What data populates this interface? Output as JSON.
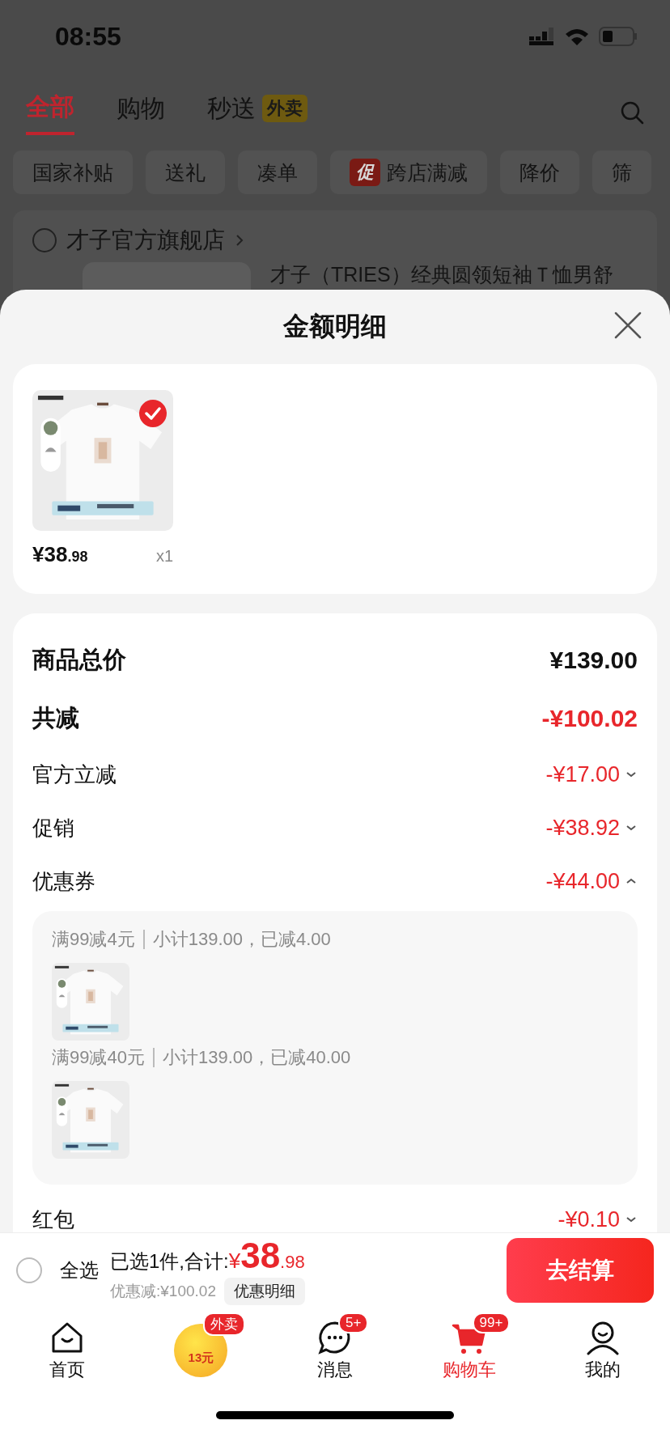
{
  "status_bar": {
    "time": "08:55"
  },
  "top_tabs": [
    {
      "label": "全部",
      "selected": true
    },
    {
      "label": "购物",
      "selected": false
    },
    {
      "label": "秒送",
      "selected": false,
      "badge": "外卖"
    }
  ],
  "filter_chips": [
    {
      "label": "国家补贴"
    },
    {
      "label": "送礼"
    },
    {
      "label": "凑单"
    },
    {
      "label": "跨店满减",
      "tag": "促"
    },
    {
      "label": "降价"
    },
    {
      "label": "筛"
    }
  ],
  "store": {
    "name": "才子官方旗舰店",
    "checked": false,
    "product_title": "才子（TRIES）经典圆领短袖Ｔ恤男舒"
  },
  "sheet": {
    "title": "金额明细",
    "items": [
      {
        "price": "¥38",
        "price_decimal": ".98",
        "quantity": "x1",
        "checked": true
      }
    ],
    "summary": [
      {
        "label": "商品总价",
        "value": "¥139.00",
        "kind": "total"
      },
      {
        "label": "共减",
        "value": "-¥100.02",
        "kind": "discount_total"
      },
      {
        "label": "官方立减",
        "value": "-¥17.00",
        "kind": "discount",
        "expanded": false
      },
      {
        "label": "促销",
        "value": "-¥38.92",
        "kind": "discount",
        "expanded": false
      },
      {
        "label": "优惠券",
        "value": "-¥44.00",
        "kind": "discount",
        "expanded": true,
        "breakdown": [
          {
            "rule": "满99减4元",
            "detail": "小计139.00，已减4.00"
          },
          {
            "rule": "满99减40元",
            "detail": "小计139.00，已减40.00"
          }
        ]
      },
      {
        "label": "红包",
        "value": "-¥0.10",
        "kind": "discount",
        "expanded": false
      }
    ]
  },
  "checkout": {
    "select_all": {
      "label": "全选",
      "checked": false
    },
    "summary": "已选1件,合计:",
    "currency": "¥",
    "amount": "38",
    "decimal": ".98",
    "savings": "优惠减:¥100.02",
    "details_button": "优惠明细",
    "submit": "去结算"
  },
  "tab_bar": [
    {
      "label": "首页",
      "kind": "home",
      "selected": false
    },
    {
      "kind": "promo",
      "text": "13元",
      "badge": "外卖",
      "selected": false
    },
    {
      "label": "消息",
      "kind": "messages",
      "badge": "5+",
      "selected": false
    },
    {
      "label": "购物车",
      "kind": "cart",
      "badge": "99+",
      "selected": true
    },
    {
      "label": "我的",
      "kind": "profile",
      "selected": false
    }
  ]
}
